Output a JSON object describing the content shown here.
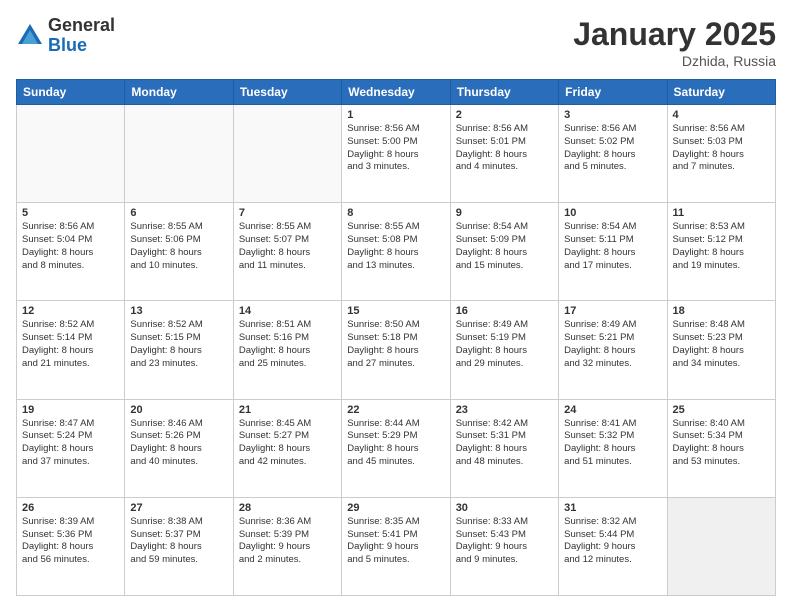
{
  "logo": {
    "general": "General",
    "blue": "Blue"
  },
  "title": "January 2025",
  "location": "Dzhida, Russia",
  "days_of_week": [
    "Sunday",
    "Monday",
    "Tuesday",
    "Wednesday",
    "Thursday",
    "Friday",
    "Saturday"
  ],
  "weeks": [
    [
      {
        "day": "",
        "info": ""
      },
      {
        "day": "",
        "info": ""
      },
      {
        "day": "",
        "info": ""
      },
      {
        "day": "1",
        "info": "Sunrise: 8:56 AM\nSunset: 5:00 PM\nDaylight: 8 hours\nand 3 minutes."
      },
      {
        "day": "2",
        "info": "Sunrise: 8:56 AM\nSunset: 5:01 PM\nDaylight: 8 hours\nand 4 minutes."
      },
      {
        "day": "3",
        "info": "Sunrise: 8:56 AM\nSunset: 5:02 PM\nDaylight: 8 hours\nand 5 minutes."
      },
      {
        "day": "4",
        "info": "Sunrise: 8:56 AM\nSunset: 5:03 PM\nDaylight: 8 hours\nand 7 minutes."
      }
    ],
    [
      {
        "day": "5",
        "info": "Sunrise: 8:56 AM\nSunset: 5:04 PM\nDaylight: 8 hours\nand 8 minutes."
      },
      {
        "day": "6",
        "info": "Sunrise: 8:55 AM\nSunset: 5:06 PM\nDaylight: 8 hours\nand 10 minutes."
      },
      {
        "day": "7",
        "info": "Sunrise: 8:55 AM\nSunset: 5:07 PM\nDaylight: 8 hours\nand 11 minutes."
      },
      {
        "day": "8",
        "info": "Sunrise: 8:55 AM\nSunset: 5:08 PM\nDaylight: 8 hours\nand 13 minutes."
      },
      {
        "day": "9",
        "info": "Sunrise: 8:54 AM\nSunset: 5:09 PM\nDaylight: 8 hours\nand 15 minutes."
      },
      {
        "day": "10",
        "info": "Sunrise: 8:54 AM\nSunset: 5:11 PM\nDaylight: 8 hours\nand 17 minutes."
      },
      {
        "day": "11",
        "info": "Sunrise: 8:53 AM\nSunset: 5:12 PM\nDaylight: 8 hours\nand 19 minutes."
      }
    ],
    [
      {
        "day": "12",
        "info": "Sunrise: 8:52 AM\nSunset: 5:14 PM\nDaylight: 8 hours\nand 21 minutes."
      },
      {
        "day": "13",
        "info": "Sunrise: 8:52 AM\nSunset: 5:15 PM\nDaylight: 8 hours\nand 23 minutes."
      },
      {
        "day": "14",
        "info": "Sunrise: 8:51 AM\nSunset: 5:16 PM\nDaylight: 8 hours\nand 25 minutes."
      },
      {
        "day": "15",
        "info": "Sunrise: 8:50 AM\nSunset: 5:18 PM\nDaylight: 8 hours\nand 27 minutes."
      },
      {
        "day": "16",
        "info": "Sunrise: 8:49 AM\nSunset: 5:19 PM\nDaylight: 8 hours\nand 29 minutes."
      },
      {
        "day": "17",
        "info": "Sunrise: 8:49 AM\nSunset: 5:21 PM\nDaylight: 8 hours\nand 32 minutes."
      },
      {
        "day": "18",
        "info": "Sunrise: 8:48 AM\nSunset: 5:23 PM\nDaylight: 8 hours\nand 34 minutes."
      }
    ],
    [
      {
        "day": "19",
        "info": "Sunrise: 8:47 AM\nSunset: 5:24 PM\nDaylight: 8 hours\nand 37 minutes."
      },
      {
        "day": "20",
        "info": "Sunrise: 8:46 AM\nSunset: 5:26 PM\nDaylight: 8 hours\nand 40 minutes."
      },
      {
        "day": "21",
        "info": "Sunrise: 8:45 AM\nSunset: 5:27 PM\nDaylight: 8 hours\nand 42 minutes."
      },
      {
        "day": "22",
        "info": "Sunrise: 8:44 AM\nSunset: 5:29 PM\nDaylight: 8 hours\nand 45 minutes."
      },
      {
        "day": "23",
        "info": "Sunrise: 8:42 AM\nSunset: 5:31 PM\nDaylight: 8 hours\nand 48 minutes."
      },
      {
        "day": "24",
        "info": "Sunrise: 8:41 AM\nSunset: 5:32 PM\nDaylight: 8 hours\nand 51 minutes."
      },
      {
        "day": "25",
        "info": "Sunrise: 8:40 AM\nSunset: 5:34 PM\nDaylight: 8 hours\nand 53 minutes."
      }
    ],
    [
      {
        "day": "26",
        "info": "Sunrise: 8:39 AM\nSunset: 5:36 PM\nDaylight: 8 hours\nand 56 minutes."
      },
      {
        "day": "27",
        "info": "Sunrise: 8:38 AM\nSunset: 5:37 PM\nDaylight: 8 hours\nand 59 minutes."
      },
      {
        "day": "28",
        "info": "Sunrise: 8:36 AM\nSunset: 5:39 PM\nDaylight: 9 hours\nand 2 minutes."
      },
      {
        "day": "29",
        "info": "Sunrise: 8:35 AM\nSunset: 5:41 PM\nDaylight: 9 hours\nand 5 minutes."
      },
      {
        "day": "30",
        "info": "Sunrise: 8:33 AM\nSunset: 5:43 PM\nDaylight: 9 hours\nand 9 minutes."
      },
      {
        "day": "31",
        "info": "Sunrise: 8:32 AM\nSunset: 5:44 PM\nDaylight: 9 hours\nand 12 minutes."
      },
      {
        "day": "",
        "info": ""
      }
    ]
  ]
}
